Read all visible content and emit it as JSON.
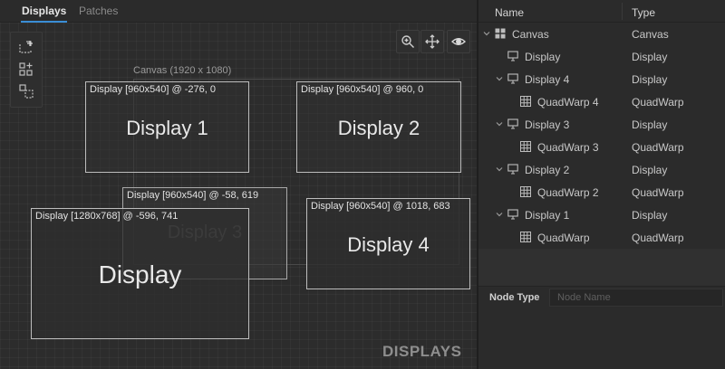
{
  "tabs": {
    "displays": "Displays",
    "patches": "Patches"
  },
  "viewport": {
    "canvas_label": "Canvas (1920 x 1080)",
    "watermark": "DISPLAYS",
    "tools": [
      "add-display-icon",
      "add-grid-icon",
      "select-region-icon"
    ],
    "view_buttons": [
      "zoom-icon",
      "move-icon",
      "eye-icon"
    ]
  },
  "displays": [
    {
      "label": "Display [960x540] @ -276, 0",
      "title": "Display 1"
    },
    {
      "label": "Display [960x540] @ 960, 0",
      "title": "Display 2"
    },
    {
      "label": "Display [960x540] @ -58, 619",
      "title": "Display 3"
    },
    {
      "label": "Display [960x540] @ 1018, 683",
      "title": "Display 4"
    },
    {
      "label": "Display [1280x768] @ -596, 741",
      "title": "Display"
    }
  ],
  "tree": {
    "header": {
      "name": "Name",
      "type": "Type"
    },
    "rows": [
      {
        "name": "Canvas",
        "type": "Canvas",
        "icon": "canvas-icon",
        "expanded": true
      },
      {
        "name": "Display",
        "type": "Display",
        "icon": "monitor-icon"
      },
      {
        "name": "Display 4",
        "type": "Display",
        "icon": "monitor-icon",
        "expanded": true
      },
      {
        "name": "QuadWarp 4",
        "type": "QuadWarp",
        "icon": "grid-icon"
      },
      {
        "name": "Display 3",
        "type": "Display",
        "icon": "monitor-icon",
        "expanded": true
      },
      {
        "name": "QuadWarp 3",
        "type": "QuadWarp",
        "icon": "grid-icon"
      },
      {
        "name": "Display 2",
        "type": "Display",
        "icon": "monitor-icon",
        "expanded": true
      },
      {
        "name": "QuadWarp 2",
        "type": "QuadWarp",
        "icon": "grid-icon"
      },
      {
        "name": "Display 1",
        "type": "Display",
        "icon": "monitor-icon",
        "expanded": true
      },
      {
        "name": "QuadWarp",
        "type": "QuadWarp",
        "icon": "grid-icon"
      }
    ]
  },
  "node_panel": {
    "type_label": "Node Type",
    "name_placeholder": "Node Name"
  },
  "colors": {
    "accent": "#3a8ed6",
    "background": "#2b2b2b",
    "display_border": "#bdbdbd"
  }
}
